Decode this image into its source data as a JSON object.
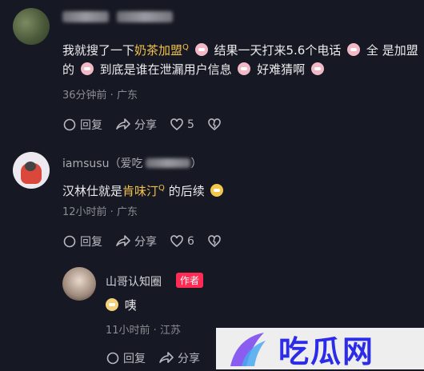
{
  "comments": [
    {
      "text": {
        "p1": "我就搜了一下",
        "hl1": "奶茶加盟",
        "p2": "结果一天打来5.6个电话",
        "p3": "全",
        "p4": "是加盟的",
        "p5": "到底是谁在泄漏用户信息",
        "p6": "好难猜啊"
      },
      "meta": "36分钟前 · 广东",
      "reply_label": "回复",
      "share_label": "分享",
      "likes": "5"
    },
    {
      "username": "iamsusu",
      "username_suffix": "（爱吃",
      "username_end": "）",
      "text": {
        "p1": "汉林仕就是",
        "hl1": "肯味汀",
        "p2": "的后续"
      },
      "meta": "12小时前 · 广东",
      "reply_label": "回复",
      "share_label": "分享",
      "likes": "6"
    },
    {
      "username": "山哥认知圈",
      "badge": "作者",
      "text": "咦",
      "meta": "11小时前 · 江苏",
      "reply_label": "回复",
      "share_label": "分享"
    }
  ],
  "search_marker": "Q",
  "watermark": "吃瓜网",
  "icons": [
    "reply-icon",
    "share-icon",
    "heart-icon",
    "dislike-icon",
    "search-marker-icon",
    "emoji-icon"
  ]
}
